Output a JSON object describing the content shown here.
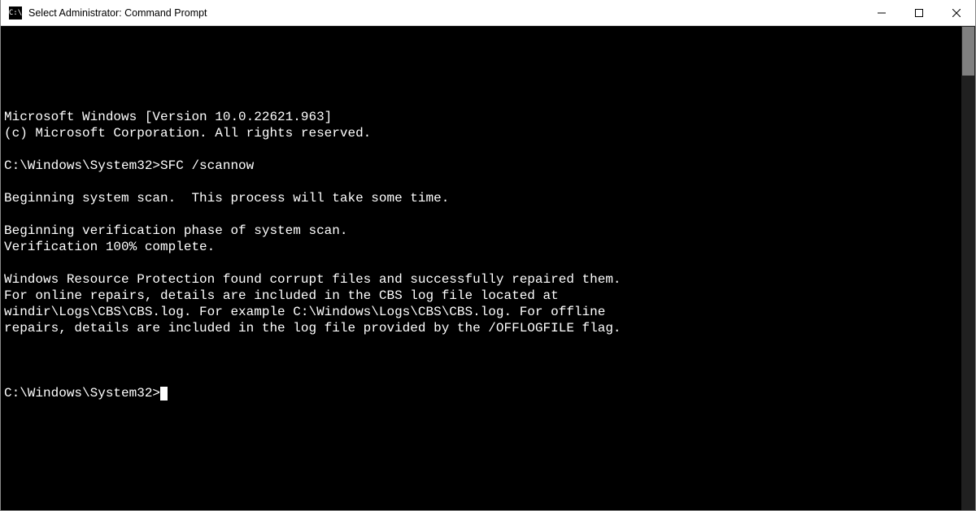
{
  "titlebar": {
    "icon_label": "C:\\",
    "title": "Select Administrator: Command Prompt"
  },
  "terminal": {
    "lines": [
      "Microsoft Windows [Version 10.0.22621.963]",
      "(c) Microsoft Corporation. All rights reserved.",
      "",
      "C:\\Windows\\System32>SFC /scannow",
      "",
      "Beginning system scan.  This process will take some time.",
      "",
      "Beginning verification phase of system scan.",
      "Verification 100% complete.",
      "",
      "Windows Resource Protection found corrupt files and successfully repaired them.",
      "For online repairs, details are included in the CBS log file located at",
      "windir\\Logs\\CBS\\CBS.log. For example C:\\Windows\\Logs\\CBS\\CBS.log. For offline",
      "repairs, details are included in the log file provided by the /OFFLOGFILE flag.",
      ""
    ],
    "prompt": "C:\\Windows\\System32>"
  }
}
